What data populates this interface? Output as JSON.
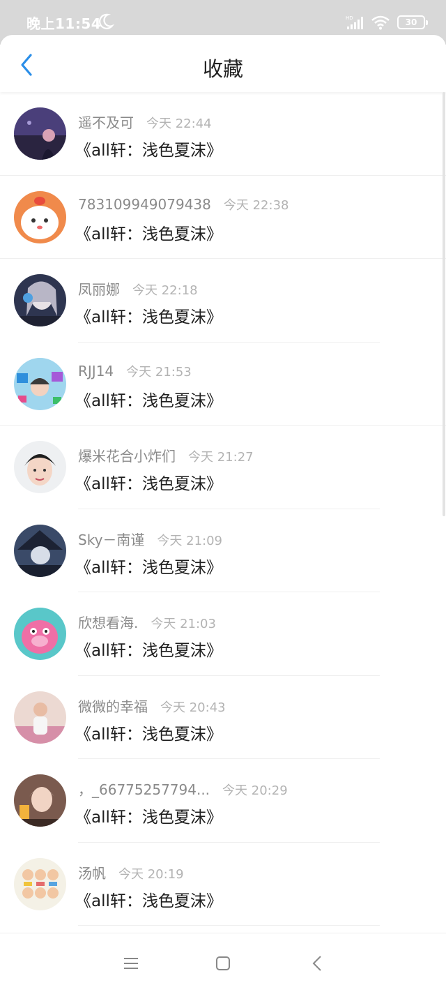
{
  "status_bar": {
    "time": "晚上11:54",
    "battery": "30"
  },
  "header": {
    "title": "收藏"
  },
  "items": [
    {
      "name": "遥不及可",
      "time": "今天 22:44",
      "title": "《all轩：浅色夏沫》"
    },
    {
      "name": "783109949079438",
      "time": "今天 22:38",
      "title": "《all轩：浅色夏沫》"
    },
    {
      "name": "凤丽娜",
      "time": "今天 22:18",
      "title": "《all轩：浅色夏沫》"
    },
    {
      "name": "RJJ14",
      "time": "今天 21:53",
      "title": "《all轩：浅色夏沫》"
    },
    {
      "name": "爆米花合小炸们",
      "time": "今天 21:27",
      "title": "《all轩：浅色夏沫》"
    },
    {
      "name": "Sky－南谨",
      "time": "今天 21:09",
      "title": "《all轩：浅色夏沫》"
    },
    {
      "name": "欣想看海.",
      "time": "今天 21:03",
      "title": "《all轩：浅色夏沫》"
    },
    {
      "name": "微微的幸福",
      "time": "今天 20:43",
      "title": "《all轩：浅色夏沫》"
    },
    {
      "name": "，_66775257794...",
      "time": "今天 20:29",
      "title": "《all轩：浅色夏沫》"
    },
    {
      "name": "汤帆",
      "time": "今天 20:19",
      "title": "《all轩：浅色夏沫》"
    }
  ],
  "colors": {
    "accent": "#2a8ee8",
    "name": "#8a8a8a",
    "time": "#b3b3b3"
  },
  "icons": {
    "back": "chevron-left-icon",
    "menu": "menu-lines-icon",
    "home": "square-home-icon",
    "nav_back": "triangle-back-icon"
  }
}
